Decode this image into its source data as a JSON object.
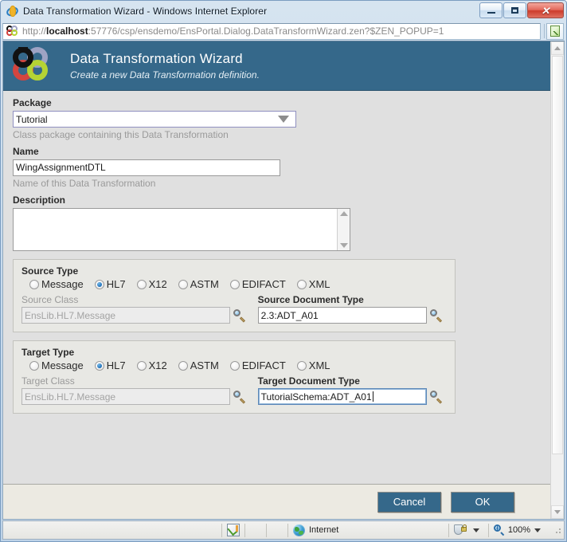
{
  "window": {
    "title": "Data Transformation Wizard - Windows Internet Explorer",
    "minimize_label": "",
    "maximize_label": "",
    "close_label": "✕"
  },
  "address": {
    "url_prefix": "http://",
    "url_host": "localhost",
    "url_rest": ":57776/csp/ensdemo/EnsPortal.Dialog.DataTransformWizard.zen?$ZEN_POPUP=1",
    "favicon_name": "intersystems-logo-icon",
    "refresh_icon_name": "page-icon"
  },
  "banner": {
    "title": "Data Transformation Wizard",
    "subtitle": "Create a new Data Transformation definition.",
    "logo_name": "intersystems-rings-logo",
    "bg_color": "#35688a"
  },
  "form": {
    "package": {
      "label": "Package",
      "value": "Tutorial",
      "hint": "Class package containing this Data Transformation"
    },
    "name": {
      "label": "Name",
      "value": "WingAssignmentDTL",
      "hint": "Name of this Data Transformation"
    },
    "description": {
      "label": "Description",
      "value": ""
    },
    "source": {
      "group_label": "Source Type",
      "options": [
        {
          "label": "Message",
          "checked": false
        },
        {
          "label": "HL7",
          "checked": true
        },
        {
          "label": "X12",
          "checked": false
        },
        {
          "label": "ASTM",
          "checked": false
        },
        {
          "label": "EDIFACT",
          "checked": false
        },
        {
          "label": "XML",
          "checked": false
        }
      ],
      "class_label": "Source Class",
      "class_value": "EnsLib.HL7.Message",
      "class_disabled": true,
      "doctype_label": "Source Document Type",
      "doctype_value": "2.3:ADT_A01",
      "doctype_focused": false
    },
    "target": {
      "group_label": "Target Type",
      "options": [
        {
          "label": "Message",
          "checked": false
        },
        {
          "label": "HL7",
          "checked": true
        },
        {
          "label": "X12",
          "checked": false
        },
        {
          "label": "ASTM",
          "checked": false
        },
        {
          "label": "EDIFACT",
          "checked": false
        },
        {
          "label": "XML",
          "checked": false
        }
      ],
      "class_label": "Target Class",
      "class_value": "EnsLib.HL7.Message",
      "class_disabled": true,
      "doctype_label": "Target Document Type",
      "doctype_value": "TutorialSchema:ADT_A01",
      "doctype_focused": true
    }
  },
  "buttons": {
    "cancel": "Cancel",
    "ok": "OK",
    "accent_color": "#35688a"
  },
  "statusbar": {
    "zone": "Internet",
    "zone_icon_name": "internet-zone-globe-icon",
    "protected_icon_name": "protected-mode-shield-icon",
    "zoom_icon_name": "zoom-magnifier-icon",
    "zoom": "100%",
    "notify_icon_name": "notification-icon"
  }
}
